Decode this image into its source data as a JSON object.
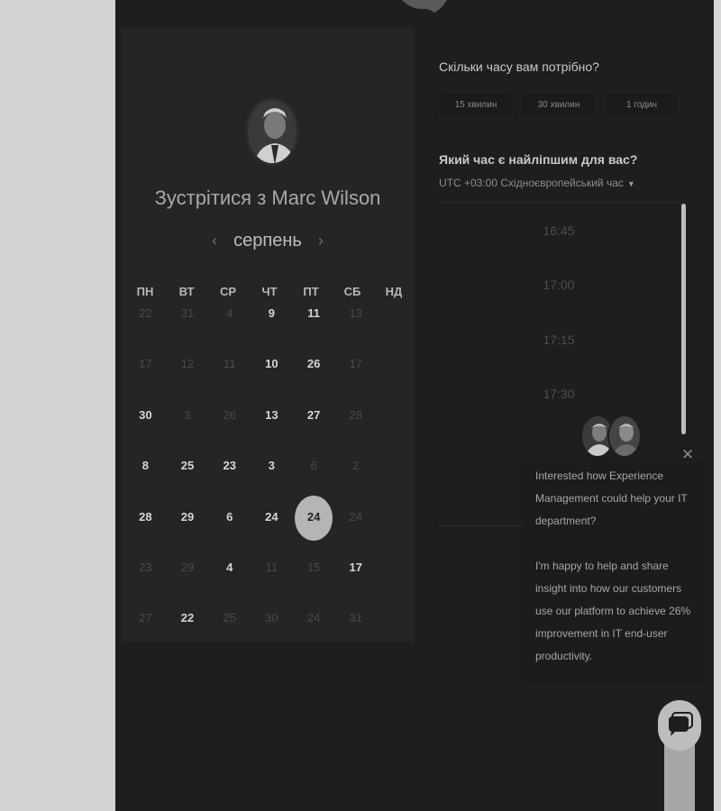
{
  "calendar": {
    "title": "Зустрітися з Marc Wilson",
    "month": "серпень",
    "weekdays": [
      "ПН",
      "ВТ",
      "СР",
      "ЧТ",
      "ПТ",
      "СБ",
      "НД"
    ],
    "days": [
      {
        "d": "22",
        "s": "off"
      },
      {
        "d": "31",
        "s": "off"
      },
      {
        "d": "4",
        "s": "off"
      },
      {
        "d": "9",
        "s": "avail"
      },
      {
        "d": "11",
        "s": "avail"
      },
      {
        "d": "13",
        "s": "off"
      },
      {
        "d": "17",
        "s": "off"
      },
      {
        "d": "12",
        "s": "off"
      },
      {
        "d": "11",
        "s": "off"
      },
      {
        "d": "10",
        "s": "avail"
      },
      {
        "d": "26",
        "s": "avail"
      },
      {
        "d": "17",
        "s": "off"
      },
      {
        "d": "30",
        "s": "avail"
      },
      {
        "d": "3",
        "s": "off"
      },
      {
        "d": "26",
        "s": "off"
      },
      {
        "d": "13",
        "s": "avail"
      },
      {
        "d": "27",
        "s": "avail"
      },
      {
        "d": "28",
        "s": "off"
      },
      {
        "d": "8",
        "s": "avail"
      },
      {
        "d": "25",
        "s": "avail"
      },
      {
        "d": "23",
        "s": "avail"
      },
      {
        "d": "3",
        "s": "avail"
      },
      {
        "d": "6",
        "s": "off"
      },
      {
        "d": "2",
        "s": "off"
      },
      {
        "d": "28",
        "s": "avail"
      },
      {
        "d": "29",
        "s": "avail"
      },
      {
        "d": "6",
        "s": "avail"
      },
      {
        "d": "24",
        "s": "avail"
      },
      {
        "d": "24",
        "s": "sel"
      },
      {
        "d": "24",
        "s": "off"
      },
      {
        "d": "23",
        "s": "off"
      },
      {
        "d": "29",
        "s": "off"
      },
      {
        "d": "4",
        "s": "avail"
      },
      {
        "d": "11",
        "s": "off"
      },
      {
        "d": "15",
        "s": "off"
      },
      {
        "d": "17",
        "s": "avail"
      },
      {
        "d": "27",
        "s": "off"
      },
      {
        "d": "22",
        "s": "avail"
      },
      {
        "d": "25",
        "s": "off"
      },
      {
        "d": "30",
        "s": "off"
      },
      {
        "d": "24",
        "s": "off"
      },
      {
        "d": "31",
        "s": "off"
      }
    ]
  },
  "duration": {
    "question": "Скільки часу вам потрібно?",
    "options": [
      "15 хвилин",
      "30 хвилин",
      "1 годин"
    ]
  },
  "time": {
    "question": "Який час є найліпшим для вас?",
    "timezone": "UTC +03:00 Східноєвропейський час",
    "slots": [
      "16:45",
      "17:00",
      "17:15",
      "17:30"
    ]
  },
  "chat": {
    "para1": "Interested how Experience Management could help your IT department?",
    "para2": "I'm happy to help and share insight into how our customers use our platform to achieve 26% improvement in IT end-user productivity."
  },
  "icons": {
    "prev": "chevron-left-icon",
    "next": "chevron-right-icon",
    "dropdown": "chevron-down-icon",
    "close": "close-icon",
    "chat": "chat-bubble-icon"
  },
  "colors": {
    "background": "#1e1e1e",
    "card": "#252525",
    "selected_day": "#b5b5b5"
  }
}
